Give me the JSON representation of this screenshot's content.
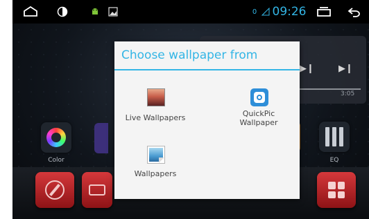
{
  "statusbar": {
    "icons": {
      "home": "home-icon",
      "brightness": "brightness-icon",
      "android": "android-icon",
      "gallery": "gallery-icon",
      "signal": "signal-icon",
      "recents": "recents-icon",
      "back": "back-icon"
    },
    "notification_count": "0",
    "clock": "09:26"
  },
  "music_widget": {
    "time": "3:05",
    "controls": [
      "play-pause-icon",
      "next-icon"
    ]
  },
  "home_apps": [
    {
      "label": "Color",
      "icon": "color-icon"
    },
    {
      "label": "EQ",
      "icon": "eq-icon"
    }
  ],
  "dock_icons": [
    "navigation-icon",
    "radio-icon",
    "apps-grid-icon"
  ],
  "dialog": {
    "title": "Choose wallpaper from",
    "options": [
      {
        "label": "Live Wallpapers",
        "icon": "live-wallpapers-icon"
      },
      {
        "label_line1": "QuickPic",
        "label_line2": "Wallpaper",
        "icon": "quickpic-icon"
      },
      {
        "label": "Wallpapers",
        "icon": "wallpapers-icon"
      }
    ]
  },
  "colors": {
    "accent": "#33b5e5",
    "dialog_bg": "#f4f4f4",
    "dock_red": "#c62a2d"
  }
}
